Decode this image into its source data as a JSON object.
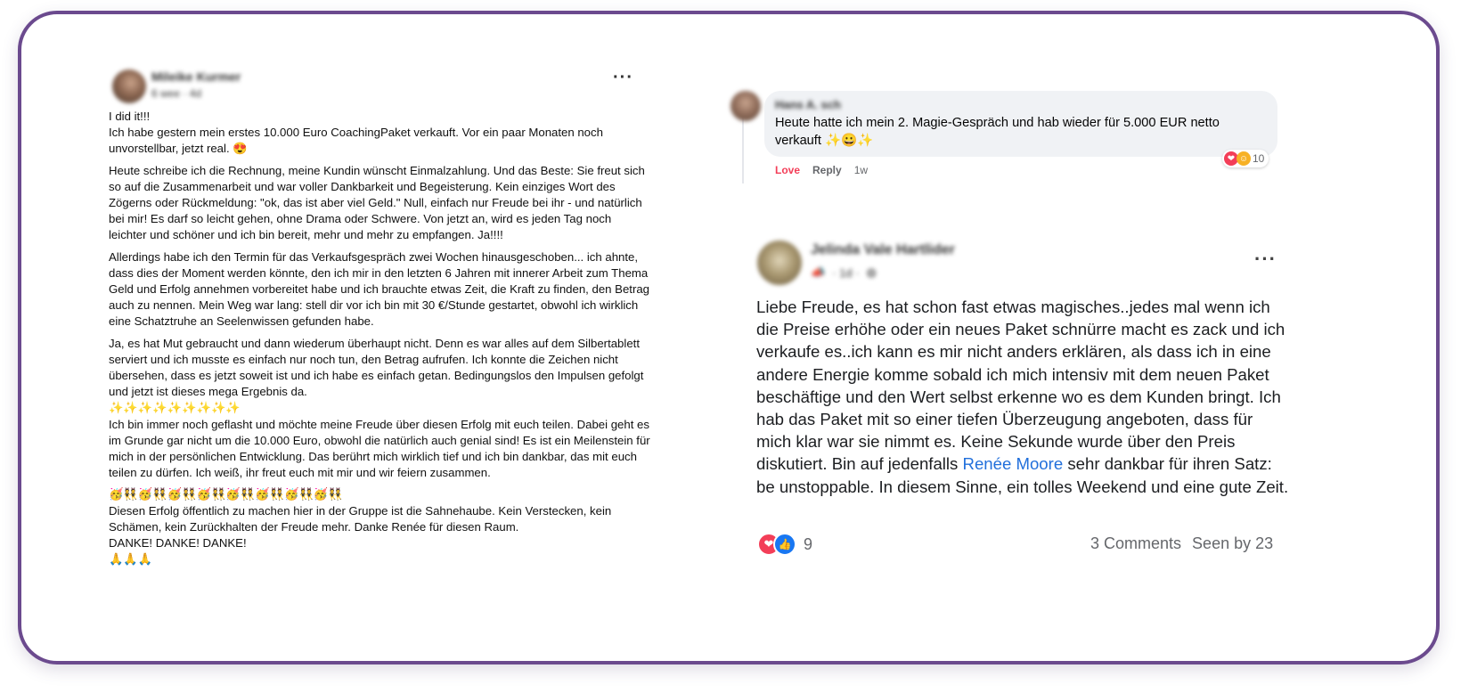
{
  "left_post": {
    "author": "Mileike Kurmer",
    "meta": "6 wee · 4d",
    "paragraphs": [
      "I did it!!!\nIch habe gestern mein erstes 10.000 Euro CoachingPaket verkauft. Vor ein paar Monaten noch unvorstellbar, jetzt real. 😍",
      "Heute schreibe ich die Rechnung, meine Kundin wünscht Einmalzahlung. Und das Beste: Sie freut sich so auf die Zusammenarbeit und war voller Dankbarkeit und Begeisterung. Kein einziges Wort des Zögerns oder Rückmeldung: \"ok, das ist aber viel Geld.\" Null, einfach nur Freude bei ihr - und natürlich bei mir! Es darf so leicht gehen, ohne Drama oder Schwere. Von jetzt an, wird es jeden Tag noch leichter und schöner und ich bin bereit, mehr und mehr zu empfangen. Ja!!!!",
      "Allerdings habe ich den Termin für das Verkaufsgespräch zwei Wochen hinausgeschoben... ich ahnte, dass dies der Moment werden könnte, den ich mir in den letzten 6 Jahren mit innerer Arbeit zum Thema Geld und Erfolg annehmen vorbereitet habe und ich brauchte etwas Zeit, die Kraft zu finden, den Betrag auch zu nennen. Mein Weg war lang: stell dir vor ich bin mit 30 €/Stunde gestartet, obwohl ich wirklich eine Schatztruhe an Seelenwissen gefunden habe.",
      "Ja, es hat Mut gebraucht und dann wiederum überhaupt nicht. Denn es war alles auf dem Silbertablett serviert und ich musste es einfach nur noch tun, den Betrag aufrufen. Ich konnte die Zeichen nicht übersehen, dass es jetzt soweit ist und ich habe es einfach getan. Bedingungslos den Impulsen gefolgt und jetzt ist dieses mega Ergebnis da.\n✨✨✨✨✨✨✨✨✨\nIch bin immer noch geflasht und möchte meine Freude über diesen Erfolg mit euch teilen. Dabei geht es im Grunde gar nicht um die 10.000 Euro, obwohl die natürlich auch genial sind! Es ist ein Meilenstein für mich in der persönlichen Entwicklung. Das berührt mich wirklich tief und ich bin dankbar, das mit euch teilen zu dürfen. Ich weiß, ihr freut euch mit mir und wir feiern zusammen.",
      "🥳👯🥳👯🥳👯🥳👯🥳👯🥳👯🥳👯🥳👯\nDiesen Erfolg öffentlich zu machen hier in der Gruppe ist die Sahnehaube. Kein Verstecken, kein Schämen, kein Zurückhalten der Freude mehr. Danke Renée für diesen Raum.\nDANKE! DANKE! DANKE!\n🙏🙏🙏"
    ]
  },
  "comment": {
    "author": "Hans A. sch",
    "text": "Heute hatte ich mein 2. Magie-Gespräch und hab wieder für 5.000 EUR netto verkauft ✨😀✨",
    "reaction_count": "10",
    "love_label": "Love",
    "reply_label": "Reply",
    "time": "1w"
  },
  "right_post": {
    "author": "Jelinda Vale Hartlider",
    "meta": "· 1d ·",
    "body_before_link": "Liebe Freude, es hat schon fast etwas magisches..jedes mal wenn ich die Preise erhöhe oder ein neues Paket schnürre macht es zack und ich verkaufe es..ich kann es mir nicht anders erklären, als dass ich in eine andere Energie komme sobald ich mich intensiv mit dem neuen Paket beschäftige und den Wert selbst erkenne wo es dem Kunden bringt. Ich hab das Paket mit so einer tiefen Überzeugung angeboten, dass für mich klar war sie nimmt es. Keine Sekunde wurde über den Preis diskutiert.  Bin auf jedenfalls ",
    "link_text": "Renée Moore",
    "body_after_link": " sehr dankbar für ihren Satz: be unstoppable. In diesem Sinne, ein tolles Weekend und eine gute Zeit.",
    "reaction_count": "9",
    "comments_label": "3 Comments",
    "seen_label": "Seen by 23"
  },
  "colors": {
    "frame": "#6b4a8e",
    "love": "#f33e58",
    "like": "#1877f2",
    "link": "#216fdb",
    "bubble": "#f0f2f5"
  }
}
